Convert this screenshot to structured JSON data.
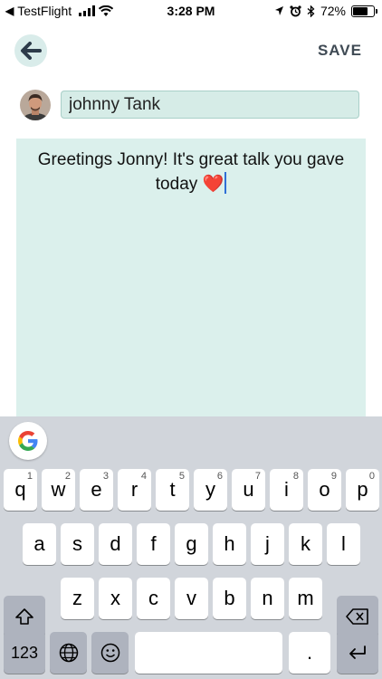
{
  "status_bar": {
    "back_indicator": "◀",
    "app_name": "TestFlight",
    "time": "3:28 PM",
    "battery_label": "72%",
    "battery_level": 0.72
  },
  "header": {
    "save_label": "SAVE"
  },
  "recipient": {
    "name": "johnny Tank"
  },
  "message": {
    "text": "Greetings Jonny! It's great talk you gave today ❤️"
  },
  "keyboard": {
    "row1": [
      {
        "label": "q",
        "hint": "1"
      },
      {
        "label": "w",
        "hint": "2"
      },
      {
        "label": "e",
        "hint": "3"
      },
      {
        "label": "r",
        "hint": "4"
      },
      {
        "label": "t",
        "hint": "5"
      },
      {
        "label": "y",
        "hint": "6"
      },
      {
        "label": "u",
        "hint": "7"
      },
      {
        "label": "i",
        "hint": "8"
      },
      {
        "label": "o",
        "hint": "9"
      },
      {
        "label": "p",
        "hint": "0"
      }
    ],
    "row2": [
      "a",
      "s",
      "d",
      "f",
      "g",
      "h",
      "j",
      "k",
      "l"
    ],
    "row3": [
      "z",
      "x",
      "c",
      "v",
      "b",
      "n",
      "m"
    ],
    "numbers_label": "123",
    "period_label": "."
  }
}
